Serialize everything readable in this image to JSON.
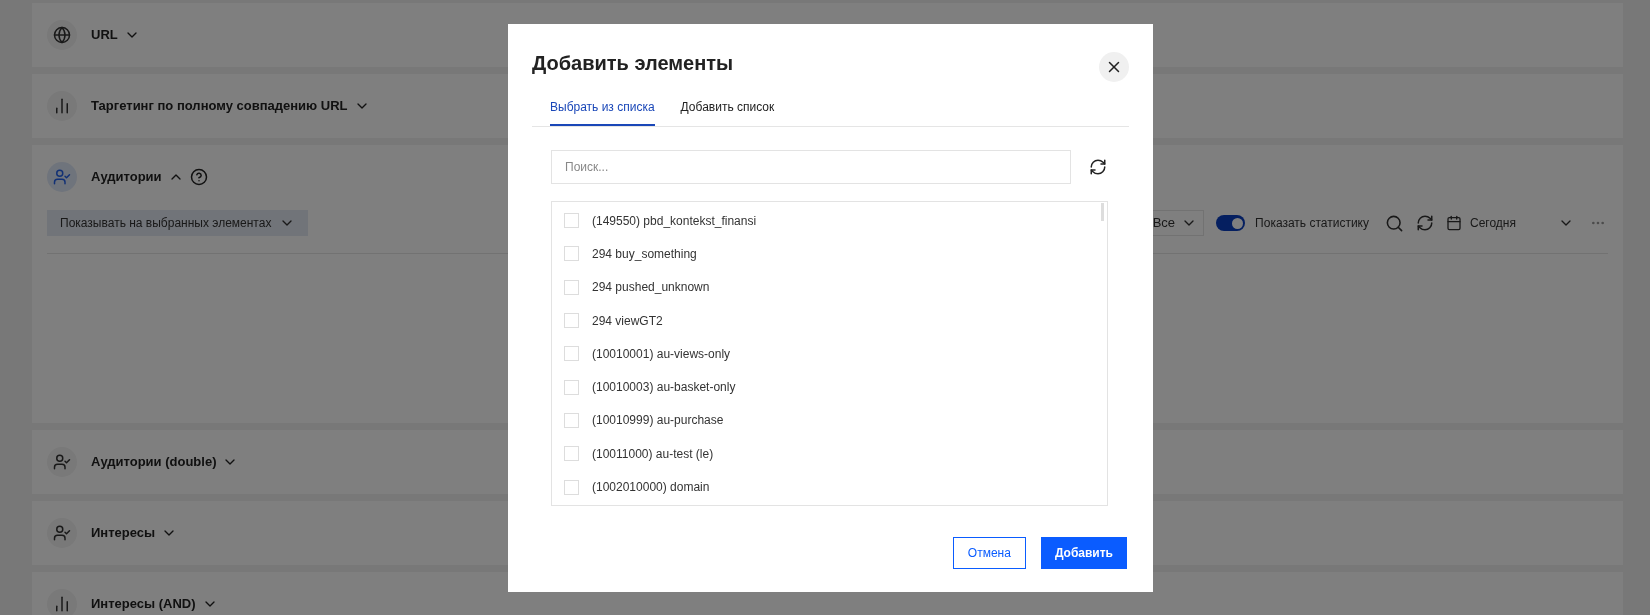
{
  "sections": [
    {
      "title": "URL",
      "kind": "globe",
      "expanded": false
    },
    {
      "title": "Таргетинг по полному совпадению URL",
      "kind": "bars",
      "expanded": false
    },
    {
      "title": "Аудитории",
      "kind": "users",
      "expanded": true,
      "help": true,
      "filter": "Показывать на выбранных элементах",
      "toolbar": {
        "select": "Все",
        "stats_toggle": {
          "label": "Показать статистику",
          "on": true
        },
        "date": "Сегодня"
      }
    },
    {
      "title": "Аудитории (double)",
      "kind": "users",
      "expanded": false
    },
    {
      "title": "Интересы",
      "kind": "users",
      "expanded": false
    },
    {
      "title": "Интересы (AND)",
      "kind": "bars",
      "expanded": false
    }
  ],
  "modal": {
    "title": "Добавить элементы",
    "tabs": [
      {
        "label": "Выбрать из списка",
        "selected": true
      },
      {
        "label": "Добавить список",
        "selected": false
      }
    ],
    "search": {
      "placeholder": "Поиск..."
    },
    "items": [
      {
        "label": "(149550) pbd_kontekst_finansi",
        "checked": false
      },
      {
        "label": "294 buy_something",
        "checked": false
      },
      {
        "label": "294 pushed_unknown",
        "checked": false
      },
      {
        "label": "294 viewGT2",
        "checked": false
      },
      {
        "label": "(10010001) au-views-only",
        "checked": false
      },
      {
        "label": "(10010003) au-basket-only",
        "checked": false
      },
      {
        "label": "(10010999) au-purchase",
        "checked": false
      },
      {
        "label": "(10011000) au-test (le)",
        "checked": false
      },
      {
        "label": "(1002010000) domain",
        "checked": false
      }
    ],
    "buttons": [
      {
        "label": "Отмена",
        "kind": "secondary"
      },
      {
        "label": "Добавить",
        "kind": "primary"
      }
    ]
  }
}
